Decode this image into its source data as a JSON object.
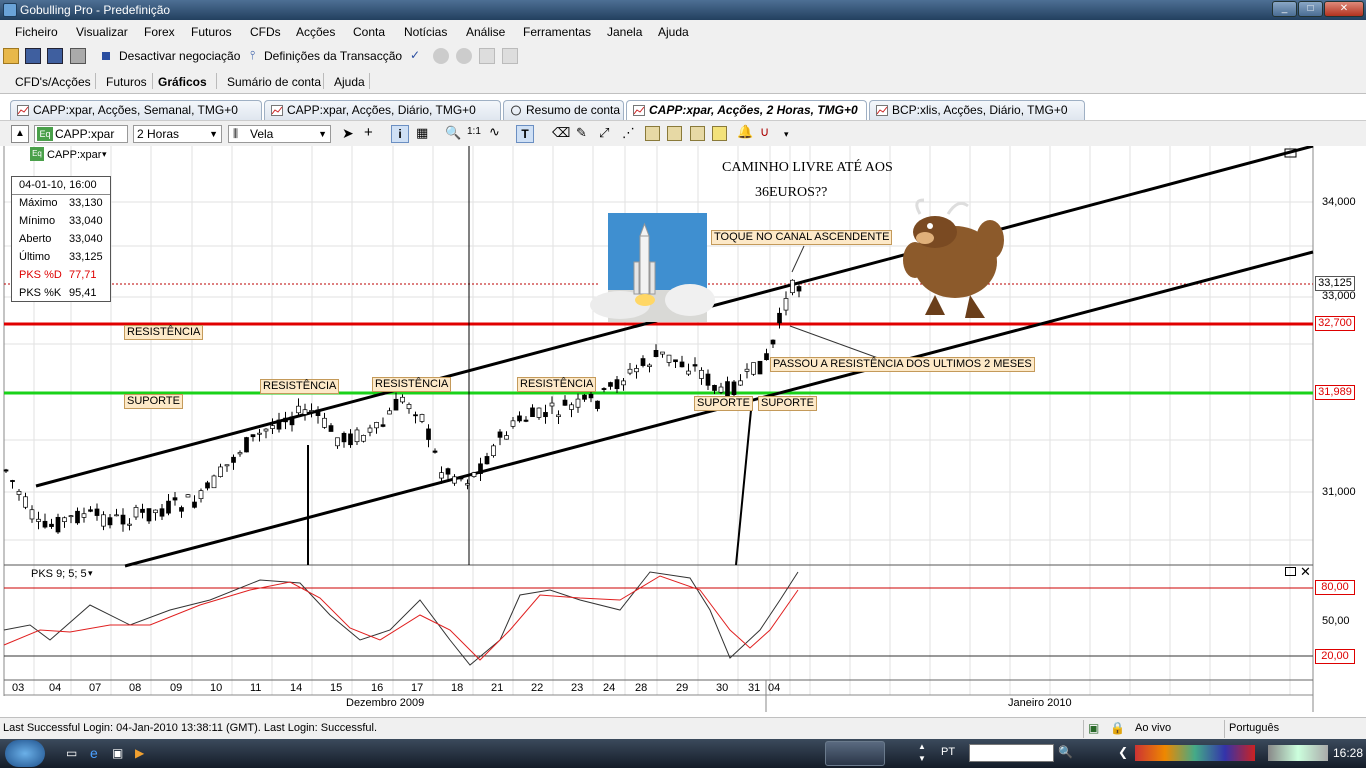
{
  "window": {
    "title": "Gobulling Pro - Predefinição",
    "btn_min": "_",
    "btn_max": "□",
    "btn_close": "✕"
  },
  "menu": [
    "Ficheiro",
    "Visualizar",
    "Forex",
    "Futuros",
    "CFDs",
    "Acções",
    "Conta",
    "Notícias",
    "Análise",
    "Ferramentas",
    "Janela",
    "Ajuda"
  ],
  "toolbar": {
    "disable_trading": "Desactivar negociação",
    "transaction_settings": "Definições da Transacção"
  },
  "main_tabs": [
    "CFD's/Acções",
    "Futuros",
    "Gráficos",
    "Sumário de conta",
    "Ajuda"
  ],
  "doc_tabs": [
    "CAPP:xpar, Acções, Semanal, TMG+0",
    "CAPP:xpar, Acções, Diário, TMG+0",
    "Resumo de conta",
    "CAPP:xpar, Acções, 2 Horas, TMG+0",
    "BCP:xlis, Acções, Diário, TMG+0"
  ],
  "chart_toolbar": {
    "symbol": "CAPP:xpar",
    "interval": "2 Horas",
    "chart_style": "Vela",
    "ratio": "1:1"
  },
  "legend_symbol": "CAPP:xpar",
  "infobox": {
    "date": "04-01-10, 16:00",
    "rows": [
      {
        "label": "Máximo",
        "value": "33,130"
      },
      {
        "label": "Mínimo",
        "value": "33,040"
      },
      {
        "label": "Aberto",
        "value": "33,040"
      },
      {
        "label": "Último",
        "value": "33,125"
      },
      {
        "label": "PKS %D",
        "value": "77,71"
      },
      {
        "label": "PKS %K",
        "value": "95,41"
      }
    ]
  },
  "annotations": {
    "title_line1": "CAMINHO LIVRE ATÉ AOS",
    "title_line2": "36EUROS??",
    "touch_channel": "TOQUE NO CANAL ASCENDENTE",
    "broke_resistance": "PASSOU A RESISTÊNCIA DOS ULTIMOS 2 MESES",
    "resistencia": "RESISTÊNCIA",
    "suporte": "SUPORTE"
  },
  "price_axis": {
    "labels": [
      "34,000",
      "33,000",
      "31,000"
    ],
    "current": "33,125",
    "red_level": "32,700",
    "green_level": "31,989"
  },
  "indicator": {
    "name": "PKS 9; 5; 5",
    "levels": [
      "80,00",
      "50,00",
      "20,00"
    ]
  },
  "x_axis": {
    "days": [
      "03",
      "04",
      "07",
      "08",
      "09",
      "10",
      "11",
      "14",
      "15",
      "16",
      "17",
      "18",
      "21",
      "22",
      "23",
      "24",
      "28",
      "29",
      "30",
      "31",
      "04"
    ],
    "month1": "Dezembro 2009",
    "month2": "Janeiro 2010"
  },
  "status": {
    "left": "Last Successful Login: 04-Jan-2010 13:38:11 (GMT). Last Login: Successful.",
    "mode": "Ao vivo",
    "language": "Português"
  },
  "taskbar": {
    "lang": "PT",
    "clock": "16:28"
  },
  "colors": {
    "resistance_red": "#e00000",
    "support_green": "#19d219",
    "channel": "#000000",
    "title_bar": "#23405f"
  }
}
